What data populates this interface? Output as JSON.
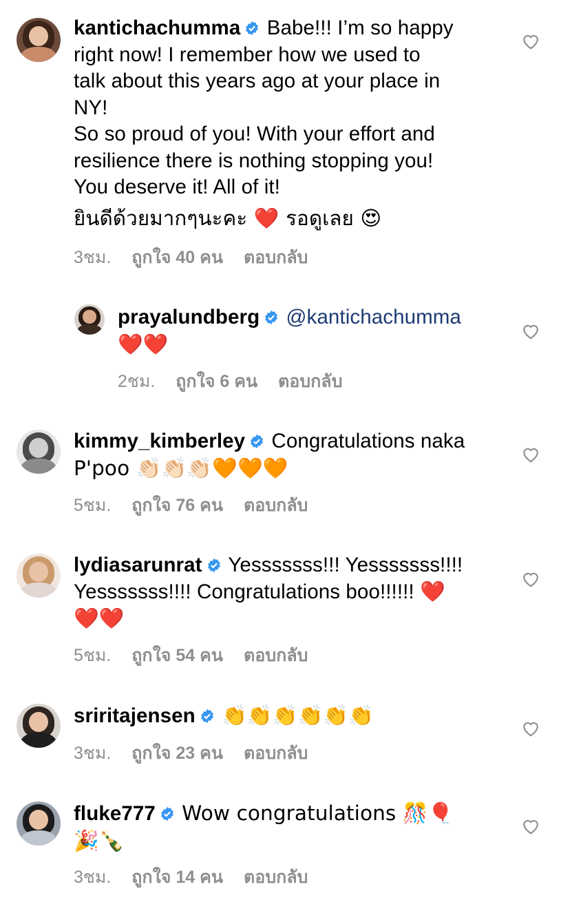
{
  "comments": [
    {
      "username": "kantichachumma",
      "lines": [
        "Babe!!! I’m so happy",
        "right now! I remember how we used to",
        "talk about this years ago at your place in",
        "NY!",
        "So so proud of you!  With your effort and",
        "resilience there is nothing stopping you!",
        "You deserve it!  All of it!",
        "ยินดีด้วยมากๆนะคะ ❤️ รอดูเลย 😍"
      ],
      "time": "3ชม.",
      "likes": "ถูกใจ 40 คน",
      "reply": "ตอบกลับ"
    },
    {
      "username": "prayalundberg",
      "mention": "@kantichachumma",
      "lines": [
        "❤️❤️"
      ],
      "time": "2ชม.",
      "likes": "ถูกใจ 6 คน",
      "reply": "ตอบกลับ"
    },
    {
      "username": "kimmy_kimberley",
      "lines": [
        "Congratulations naka",
        "P'poo 👏🏻👏🏻👏🏻🧡🧡🧡"
      ],
      "time": "5ชม.",
      "likes": "ถูกใจ 76 คน",
      "reply": "ตอบกลับ"
    },
    {
      "username": "lydiasarunrat",
      "lines": [
        "Yesssssss!!! Yesssssss!!!!",
        "Yesssssss!!!! Congratulations boo!!!!!! ❤️",
        "❤️❤️"
      ],
      "time": "5ชม.",
      "likes": "ถูกใจ 54 คน",
      "reply": "ตอบกลับ"
    },
    {
      "username": "sriritajensen",
      "lines": [
        "👏👏👏👏👏👏"
      ],
      "time": "3ชม.",
      "likes": "ถูกใจ 23 คน",
      "reply": "ตอบกลับ"
    },
    {
      "username": "fluke777",
      "lines": [
        "Wow congratulations 🎊🎈",
        "🎉🍾"
      ],
      "time": "3ชม.",
      "likes": "ถูกใจ 14 คน",
      "reply": "ตอบกลับ"
    }
  ],
  "icons": {
    "verified": "verified-badge-icon",
    "like": "heart-outline-icon"
  },
  "colors": {
    "verified": "#3897f0",
    "meta": "#8e8e8e",
    "mention": "#1d3b73"
  }
}
